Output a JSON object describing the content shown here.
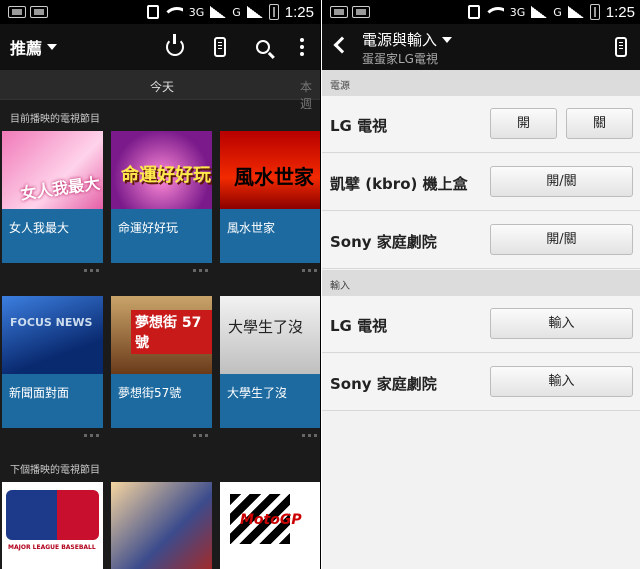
{
  "status_bar": {
    "network": "3G",
    "carrier_mark": "G",
    "time": "1:25"
  },
  "left": {
    "title": "推薦",
    "tabs": {
      "today": "今天",
      "next": "本週"
    },
    "section_current": "目前播映的電視節目",
    "section_next": "下個播映的電視節目",
    "now_shows": [
      {
        "title": "女人我最大",
        "art": "女人我最大"
      },
      {
        "title": "命運好好玩",
        "art": "命運好好玩"
      },
      {
        "title": "風水世家",
        "art": "風水世家"
      },
      {
        "title": "新聞面對面",
        "art": "FOCUS NEWS"
      },
      {
        "title": "夢想街57號",
        "art": "夢想街 57號"
      },
      {
        "title": "大學生了沒",
        "art": "大學生了沒"
      }
    ],
    "next_shows": [
      {
        "art": "MAJOR LEAGUE BASEBALL"
      },
      {
        "art": ""
      },
      {
        "art": "MotoGP"
      }
    ]
  },
  "right": {
    "title": "電源與輸入",
    "subtitle": "蛋蛋家LG電視",
    "power_header": "電源",
    "input_header": "輸入",
    "power_rows": [
      {
        "label": "LG 電視",
        "on": "開",
        "off": "關"
      },
      {
        "label": "凱擘 (kbro) 機上盒",
        "toggle": "開/關"
      },
      {
        "label": "Sony 家庭劇院",
        "toggle": "開/關"
      }
    ],
    "input_rows": [
      {
        "label": "LG 電視",
        "button": "輸入"
      },
      {
        "label": "Sony 家庭劇院",
        "button": "輸入"
      }
    ]
  }
}
